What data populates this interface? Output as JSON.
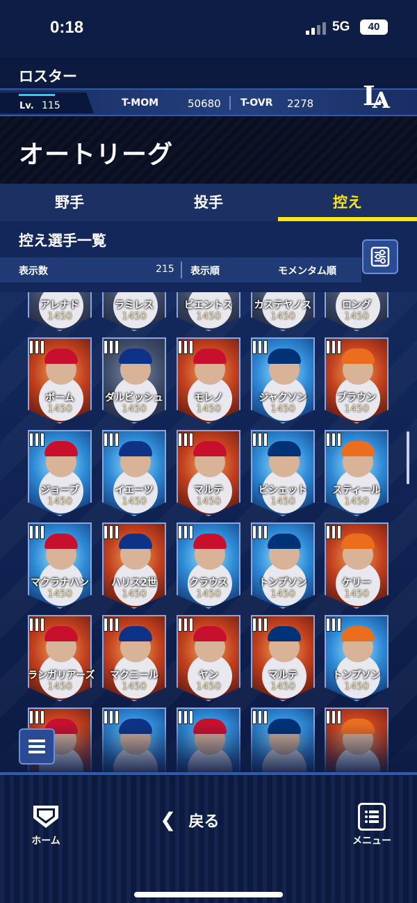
{
  "status_bar": {
    "time": "0:18",
    "network": "5G",
    "battery": "40"
  },
  "header": {
    "title": "ロスター",
    "level_label": "Lv.",
    "level_value": "115",
    "tmom_label": "T-MOM",
    "tmom_value": "50680",
    "tovr_label": "T-OVR",
    "tovr_value": "2278",
    "team_logo": "LA",
    "accent_color": "#29d1e8"
  },
  "league": {
    "name": "オートリーグ"
  },
  "tabs": [
    {
      "label": "野手",
      "active": false
    },
    {
      "label": "投手",
      "active": false
    },
    {
      "label": "控え",
      "active": true
    }
  ],
  "tab_active_color": "#ffe61a",
  "list": {
    "title": "控え選手一覧",
    "count_label": "表示数",
    "count_value": "215",
    "order_label": "表示順",
    "order_value": "モメンタム順",
    "filter_icon": "sliders-icon"
  },
  "cards": [
    {
      "name": "アレナド",
      "score": "1450",
      "style": "dark"
    },
    {
      "name": "ラミレス",
      "score": "1450",
      "style": "dark"
    },
    {
      "name": "ビエントス",
      "score": "1450",
      "style": "dark"
    },
    {
      "name": "カステヤノス",
      "score": "1450",
      "style": "dark"
    },
    {
      "name": "ロング",
      "score": "1450",
      "style": "dark"
    },
    {
      "name": "ボーム",
      "score": "1450",
      "style": "fire"
    },
    {
      "name": "ダルビッシュ",
      "score": "1450",
      "style": "dark"
    },
    {
      "name": "モレノ",
      "score": "1450",
      "style": "fire"
    },
    {
      "name": "ジャクソン",
      "score": "1450",
      "style": "ice"
    },
    {
      "name": "ブラウン",
      "score": "1450",
      "style": "fire"
    },
    {
      "name": "ジョーブ",
      "score": "1450",
      "style": "ice"
    },
    {
      "name": "イエーツ",
      "score": "1450",
      "style": "ice"
    },
    {
      "name": "マルテ",
      "score": "1450",
      "style": "fire"
    },
    {
      "name": "ビシェット",
      "score": "1450",
      "style": "ice"
    },
    {
      "name": "スティール",
      "score": "1450",
      "style": "ice"
    },
    {
      "name": "マクラナハン",
      "score": "1450",
      "style": "ice"
    },
    {
      "name": "ハリス2世",
      "score": "1450",
      "style": "fire"
    },
    {
      "name": "クラウス",
      "score": "1450",
      "style": "ice"
    },
    {
      "name": "トンプソン",
      "score": "1450",
      "style": "ice"
    },
    {
      "name": "ケリー",
      "score": "1450",
      "style": "fire"
    },
    {
      "name": "ランガリアーズ",
      "score": "1450",
      "style": "fire"
    },
    {
      "name": "マクニール",
      "score": "1450",
      "style": "fire"
    },
    {
      "name": "ヤン",
      "score": "1450",
      "style": "fire"
    },
    {
      "name": "マルテ",
      "score": "1450",
      "style": "fire"
    },
    {
      "name": "トンプソン",
      "score": "1450",
      "style": "ice"
    },
    {
      "name": "",
      "score": "",
      "style": "fire"
    },
    {
      "name": "",
      "score": "",
      "style": "ice"
    },
    {
      "name": "",
      "score": "",
      "style": "ice"
    },
    {
      "name": "",
      "score": "",
      "style": "ice"
    },
    {
      "name": "",
      "score": "",
      "style": "fire"
    }
  ],
  "bottom_nav": {
    "home_label": "ホーム",
    "back_label": "戻る",
    "menu_label": "メニュー"
  }
}
